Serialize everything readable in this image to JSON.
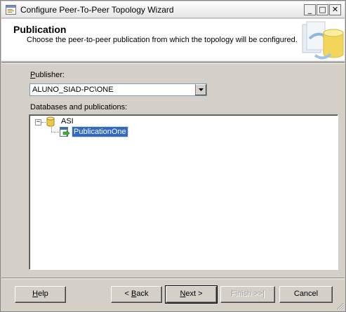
{
  "window": {
    "title": "Configure Peer-To-Peer Topology Wizard",
    "minimize_glyph": "_",
    "maximize_glyph": "□",
    "close_glyph": "✕"
  },
  "header": {
    "title": "Publication",
    "subtitle": "Choose the peer-to-peer publication from which the topology will be configured."
  },
  "publisher": {
    "label": "Publisher:",
    "selected": "ALUNO_SIAD-PC\\ONE"
  },
  "databases": {
    "label": "Databases and publications:",
    "tree": {
      "database": "ASI",
      "publication": "PublicationOne",
      "expander_glyph": "−"
    }
  },
  "buttons": {
    "help": "Help",
    "back": "< Back",
    "next": "Next >",
    "finish": "Finish >>|",
    "cancel": "Cancel"
  },
  "colors": {
    "selection": "#316ac5",
    "window_face": "#d4d0c8"
  },
  "icons": [
    "wizard-app-icon",
    "banner-database-icon",
    "dropdown-arrow-icon",
    "database-icon",
    "publication-icon",
    "resize-grip-icon"
  ]
}
